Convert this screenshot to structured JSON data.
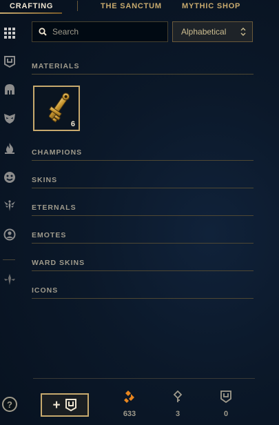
{
  "nav": {
    "tabs": [
      {
        "label": "CRAFTING",
        "active": true
      },
      {
        "label": "THE SANCTUM",
        "active": false
      },
      {
        "label": "MYTHIC SHOP",
        "active": false
      }
    ]
  },
  "sidebar": {
    "icons": [
      "grid-icon",
      "ward-icon",
      "helmet-icon",
      "mask-icon",
      "flame-icon",
      "emote-face-icon",
      "eternals-icon",
      "profile-icon",
      "chromas-icon"
    ]
  },
  "search": {
    "placeholder": "Search"
  },
  "sort": {
    "label": "Alphabetical"
  },
  "sections": {
    "materials": "MATERIALS",
    "champions": "CHAMPIONS",
    "skins": "SKINS",
    "eternals": "ETERNALS",
    "emotes": "EMOTES",
    "ward_skins": "WARD SKINS",
    "icons": "ICONS"
  },
  "materials_items": [
    {
      "icon": "hextech-key-icon",
      "count": "6"
    }
  ],
  "footer": {
    "help_label": "?",
    "add_label": "+",
    "currencies": [
      {
        "icon": "orange-essence-icon",
        "value": "633"
      },
      {
        "icon": "key-fragment-icon",
        "value": "3"
      },
      {
        "icon": "ward-token-icon",
        "value": "0"
      }
    ]
  },
  "colors": {
    "gold": "#c8aa6e",
    "orange_essence": "#e8861f",
    "background": "#0b1829"
  }
}
